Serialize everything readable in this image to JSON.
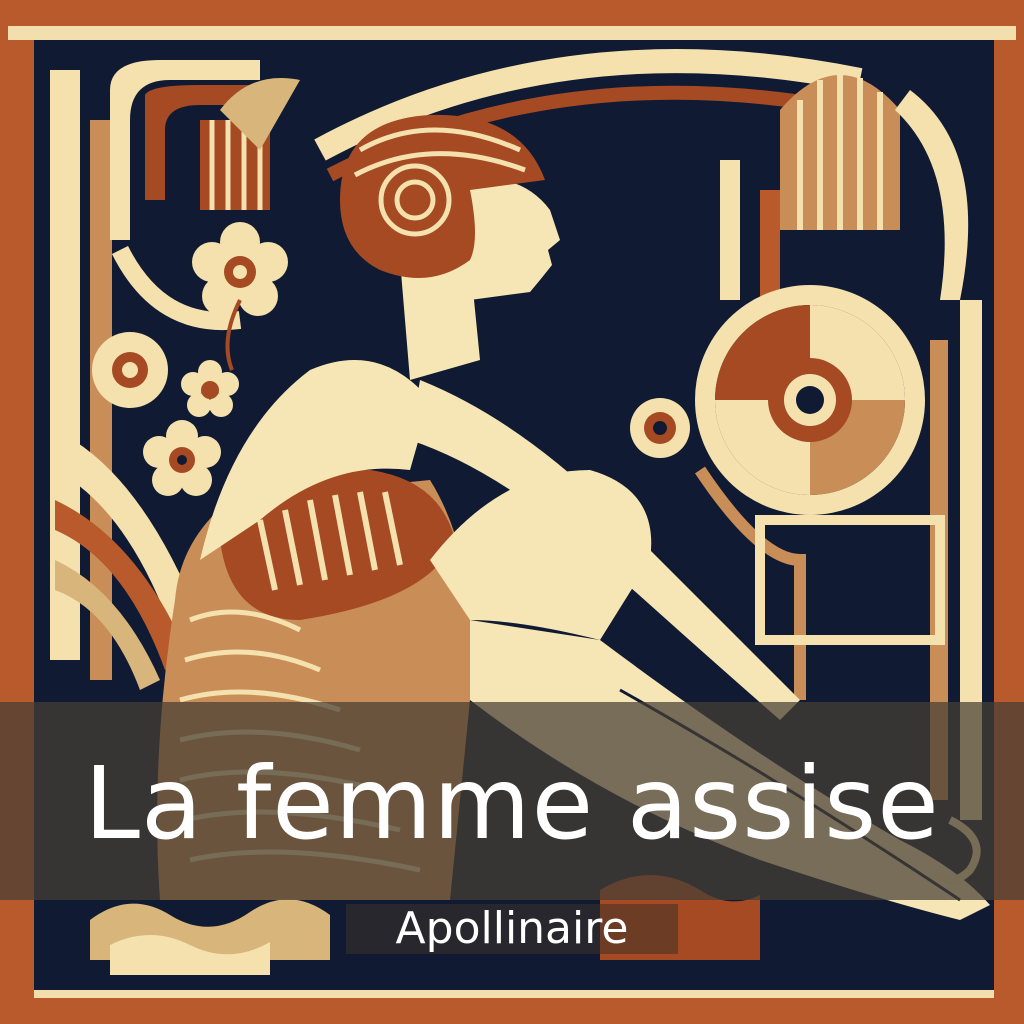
{
  "cover": {
    "title": "La femme assise",
    "author": "Apollinaire"
  },
  "palette": {
    "navy": "#101b33",
    "cream": "#f7e6b5",
    "rust": "#a64a23",
    "tan": "#c89460",
    "sand": "#d8b57a",
    "frame_orange": "#b85a2c",
    "band_overlay": "#463e34"
  },
  "illustration": {
    "style": "art-deco",
    "icons": [
      "woman-silhouette-icon",
      "flower-icon",
      "spiral-shell-icon"
    ]
  }
}
